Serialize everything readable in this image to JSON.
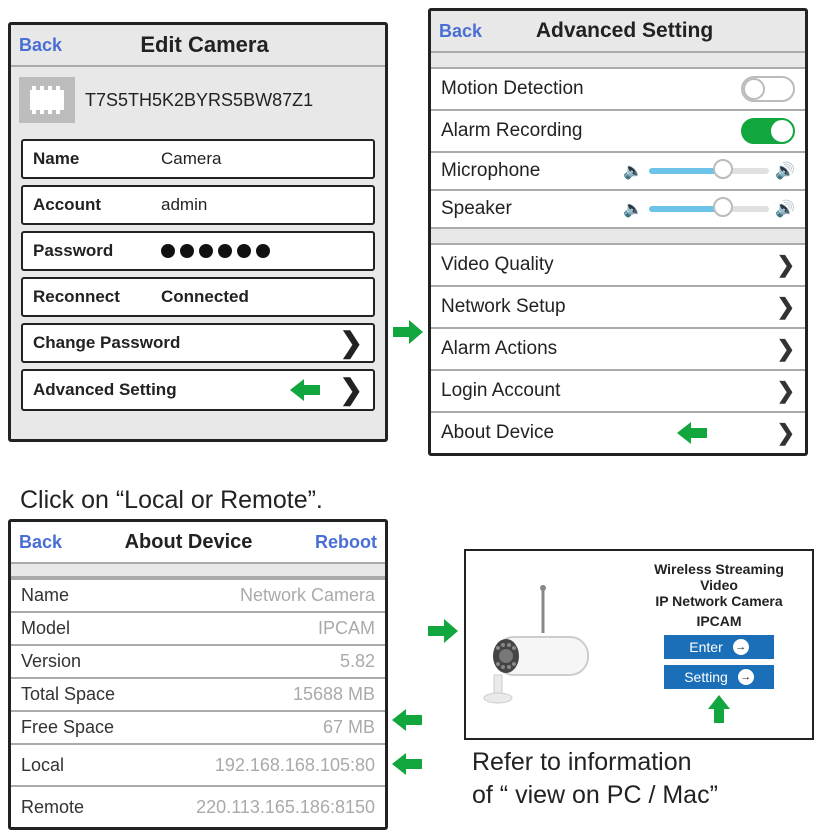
{
  "editCamera": {
    "back": "Back",
    "title": "Edit Camera",
    "cameraId": "T7S5TH5K2BYRS5BW87Z1",
    "nameLabel": "Name",
    "nameValue": "Camera",
    "accountLabel": "Account",
    "accountValue": "admin",
    "passwordLabel": "Password",
    "reconnectLabel": "Reconnect",
    "reconnectValue": "Connected",
    "changePassword": "Change Password",
    "advancedSetting": "Advanced Setting"
  },
  "advanced": {
    "back": "Back",
    "title": "Advanced Setting",
    "motionDetection": "Motion Detection",
    "alarmRecording": "Alarm Recording",
    "microphone": "Microphone",
    "speaker": "Speaker",
    "videoQuality": "Video Quality",
    "networkSetup": "Network Setup",
    "alarmActions": "Alarm Actions",
    "loginAccount": "Login Account",
    "aboutDevice": "About Device",
    "motionDetectionOn": false,
    "alarmRecordingOn": true,
    "micPercent": 62,
    "speakerPercent": 62
  },
  "instruction1": "Click on “Local or Remote”.",
  "about": {
    "back": "Back",
    "title": "About Device",
    "reboot": "Reboot",
    "rows": {
      "nameLabel": "Name",
      "nameValue": "Network Camera",
      "modelLabel": "Model",
      "modelValue": "IPCAM",
      "versionLabel": "Version",
      "versionValue": "5.82",
      "totalSpaceLabel": "Total Space",
      "totalSpaceValue": "15688 MB",
      "freeSpaceLabel": "Free Space",
      "freeSpaceValue": "67 MB",
      "localLabel": "Local",
      "localValue": "192.168.168.105:80",
      "remoteLabel": "Remote",
      "remoteValue": "220.113.165.186:8150"
    }
  },
  "webPanel": {
    "line1": "Wireless Streaming Video",
    "line2": "IP Network Camera",
    "line3": "IPCAM",
    "enter": "Enter",
    "setting": "Setting"
  },
  "caption2a": "Refer to information",
  "caption2b": "of “ view on PC / Mac”"
}
